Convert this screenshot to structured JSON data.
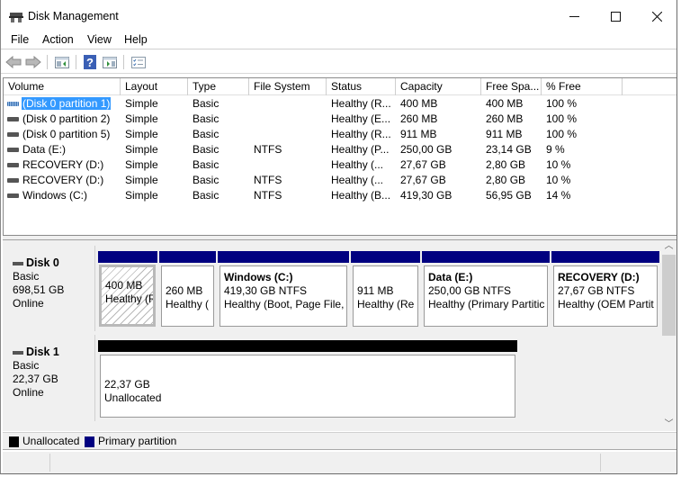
{
  "window": {
    "title": "Disk Management",
    "icon": "disk-management-icon",
    "controls": {
      "minimize": "—",
      "maximize": "☐",
      "close": "✕"
    }
  },
  "menu": [
    "File",
    "Action",
    "View",
    "Help"
  ],
  "toolbar": [
    {
      "name": "back-button",
      "icon": "arrow-left-icon"
    },
    {
      "name": "forward-button",
      "icon": "arrow-right-icon"
    },
    {
      "name": "show-hide-console-tree-button",
      "icon": "console-tree-icon"
    },
    {
      "name": "help-button",
      "icon": "help-icon"
    },
    {
      "name": "show-hide-action-pane-button",
      "icon": "action-pane-icon"
    },
    {
      "name": "properties-button",
      "icon": "properties-icon"
    }
  ],
  "volume_list": {
    "columns": [
      "Volume",
      "Layout",
      "Type",
      "File System",
      "Status",
      "Capacity",
      "Free Spa...",
      "% Free"
    ],
    "rows": [
      {
        "volume": "(Disk 0 partition 1)",
        "layout": "Simple",
        "type": "Basic",
        "fs": "",
        "status": "Healthy (R...",
        "capacity": "400 MB",
        "free": "400 MB",
        "pct": "100 %",
        "selected": true
      },
      {
        "volume": "(Disk 0 partition 2)",
        "layout": "Simple",
        "type": "Basic",
        "fs": "",
        "status": "Healthy (E...",
        "capacity": "260 MB",
        "free": "260 MB",
        "pct": "100 %"
      },
      {
        "volume": "(Disk 0 partition 5)",
        "layout": "Simple",
        "type": "Basic",
        "fs": "",
        "status": "Healthy (R...",
        "capacity": "911 MB",
        "free": "911 MB",
        "pct": "100 %"
      },
      {
        "volume": "Data (E:)",
        "layout": "Simple",
        "type": "Basic",
        "fs": "NTFS",
        "status": "Healthy (P...",
        "capacity": "250,00 GB",
        "free": "23,14 GB",
        "pct": "9 %"
      },
      {
        "volume": "RECOVERY (D:)",
        "layout": "Simple",
        "type": "Basic",
        "fs": "",
        "status": "Healthy (...",
        "capacity": "27,67 GB",
        "free": "2,80 GB",
        "pct": "10 %"
      },
      {
        "volume": "RECOVERY (D:)",
        "layout": "Simple",
        "type": "Basic",
        "fs": "NTFS",
        "status": "Healthy (...",
        "capacity": "27,67 GB",
        "free": "2,80 GB",
        "pct": "10 %"
      },
      {
        "volume": "Windows (C:)",
        "layout": "Simple",
        "type": "Basic",
        "fs": "NTFS",
        "status": "Healthy (B...",
        "capacity": "419,30 GB",
        "free": "56,95 GB",
        "pct": "14 %"
      }
    ]
  },
  "disks": [
    {
      "name": "Disk 0",
      "kind": "Basic",
      "size": "698,51 GB",
      "state": "Online",
      "partitions": [
        {
          "name": "",
          "size": "400 MB",
          "status": "Healthy (R",
          "bar": "primary",
          "selected": true
        },
        {
          "name": "",
          "size": "260 MB",
          "status": "Healthy (",
          "bar": "primary"
        },
        {
          "name": "Windows  (C:)",
          "size": "419,30 GB NTFS",
          "status": "Healthy (Boot, Page File, C",
          "bar": "primary"
        },
        {
          "name": "",
          "size": "911 MB",
          "status": "Healthy (Re",
          "bar": "primary"
        },
        {
          "name": "Data  (E:)",
          "size": "250,00 GB NTFS",
          "status": "Healthy (Primary Partitic",
          "bar": "primary"
        },
        {
          "name": "RECOVERY  (D:)",
          "size": "27,67 GB NTFS",
          "status": "Healthy (OEM Partit",
          "bar": "primary"
        }
      ]
    },
    {
      "name": "Disk 1",
      "kind": "Basic",
      "size": "22,37 GB",
      "state": "Online",
      "partitions": [
        {
          "name": "",
          "size": "22,37 GB",
          "status": "Unallocated",
          "bar": "unallocated"
        }
      ]
    }
  ],
  "legend": [
    {
      "label": "Unallocated",
      "color": "#000000"
    },
    {
      "label": "Primary partition",
      "color": "#000080"
    }
  ],
  "colors": {
    "primary": "#000080",
    "unallocated": "#000000",
    "selection": "#3399ff"
  }
}
